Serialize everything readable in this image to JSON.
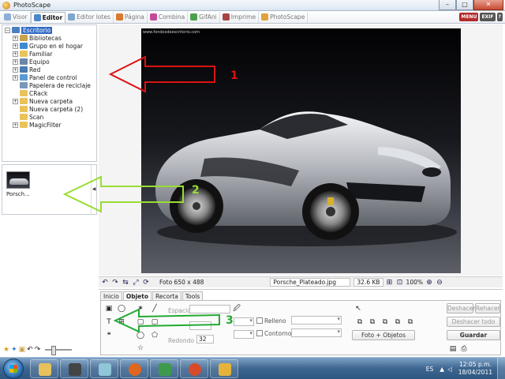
{
  "window": {
    "title": "PhotoScape",
    "controls": [
      "–",
      "□",
      "✕"
    ]
  },
  "tabs": [
    {
      "label": "Visor",
      "color": "#8fb0d6",
      "active": false
    },
    {
      "label": "Editor",
      "color": "#4c86c6",
      "active": true
    },
    {
      "label": "Editor lotes",
      "color": "#7fa6cf",
      "active": false
    },
    {
      "label": "Página",
      "color": "#d97a2f",
      "active": false
    },
    {
      "label": "Combina",
      "color": "#c44b9a",
      "active": false
    },
    {
      "label": "GifAni",
      "color": "#4aa24a",
      "active": false
    },
    {
      "label": "Imprime",
      "color": "#aa4444",
      "active": false
    },
    {
      "label": "PhotoScape",
      "color": "#e0a23a",
      "active": false
    }
  ],
  "header_icons": [
    "MENU",
    "EXIF"
  ],
  "tree": [
    {
      "label": "Escritorio",
      "expander": "-",
      "color": "#4a7fc2",
      "selected": true,
      "indent": 0
    },
    {
      "label": "Bibliotecas",
      "expander": "+",
      "color": "#c9a24a",
      "indent": 1
    },
    {
      "label": "Grupo en el hogar",
      "expander": "+",
      "color": "#3f8ad1",
      "indent": 1
    },
    {
      "label": "Familiar",
      "expander": "+",
      "color": "#e8c35a",
      "indent": 1
    },
    {
      "label": "Equipo",
      "expander": "+",
      "color": "#6b86a8",
      "indent": 1
    },
    {
      "label": "Red",
      "expander": "+",
      "color": "#4a7ab0",
      "indent": 1
    },
    {
      "label": "Panel de control",
      "expander": "+",
      "color": "#5a9ad3",
      "indent": 1
    },
    {
      "label": "Papelera de reciclaje",
      "expander": "",
      "color": "#7c98b9",
      "indent": 1
    },
    {
      "label": "CRack",
      "expander": "",
      "color": "#e8c35a",
      "indent": 1
    },
    {
      "label": "Nueva carpeta",
      "expander": "+",
      "color": "#e8c35a",
      "indent": 1
    },
    {
      "label": "Nueva carpeta (2)",
      "expander": "",
      "color": "#e8c35a",
      "indent": 1
    },
    {
      "label": "Scan",
      "expander": "",
      "color": "#e8c35a",
      "indent": 1
    },
    {
      "label": "MagicFilter",
      "expander": "+",
      "color": "#e8c35a",
      "indent": 1
    }
  ],
  "thumbnail": {
    "label": "Porsch..."
  },
  "photo": {
    "watermark": "www.fondosdeescritorio.com"
  },
  "status": {
    "size": "Foto 650 x 488",
    "filename": "Porsche_Plateado.jpg",
    "filesize": "32.6 KB",
    "zoom": "100%"
  },
  "panel_tabs": [
    {
      "label": "Inicio",
      "active": false
    },
    {
      "label": "Objeto",
      "active": true
    },
    {
      "label": "Recorta",
      "active": false
    },
    {
      "label": "Tools",
      "active": false
    }
  ],
  "panel": {
    "spacing_label": "Espacio",
    "rounded_label": "Redondo",
    "rounded_value": "32",
    "fill_label": "Relleno",
    "outline_label": "Contorno",
    "photo_objects_label": "Foto + Objetos"
  },
  "actions": {
    "undo": "Deshacer",
    "redo": "Rehacer",
    "undo_all": "Deshacer todo",
    "save": "Guardar"
  },
  "annotations": [
    {
      "number": "1",
      "color": "#dd1111"
    },
    {
      "number": "2",
      "color": "#99dd33"
    },
    {
      "number": "3",
      "color": "#22aa33"
    }
  ],
  "taskbar": {
    "apps": [
      {
        "name": "explorer",
        "color": "#e7c25a"
      },
      {
        "name": "media",
        "color": "#444444"
      },
      {
        "name": "notes",
        "color": "#8fc6d8"
      },
      {
        "name": "firefox",
        "color": "#e0661f"
      },
      {
        "name": "network",
        "color": "#3d9a4b"
      },
      {
        "name": "search",
        "color": "#d84b2a"
      },
      {
        "name": "paint",
        "color": "#e6b33a"
      }
    ],
    "language": "ES",
    "time": "12:05 p.m.",
    "date": "18/04/2011"
  }
}
